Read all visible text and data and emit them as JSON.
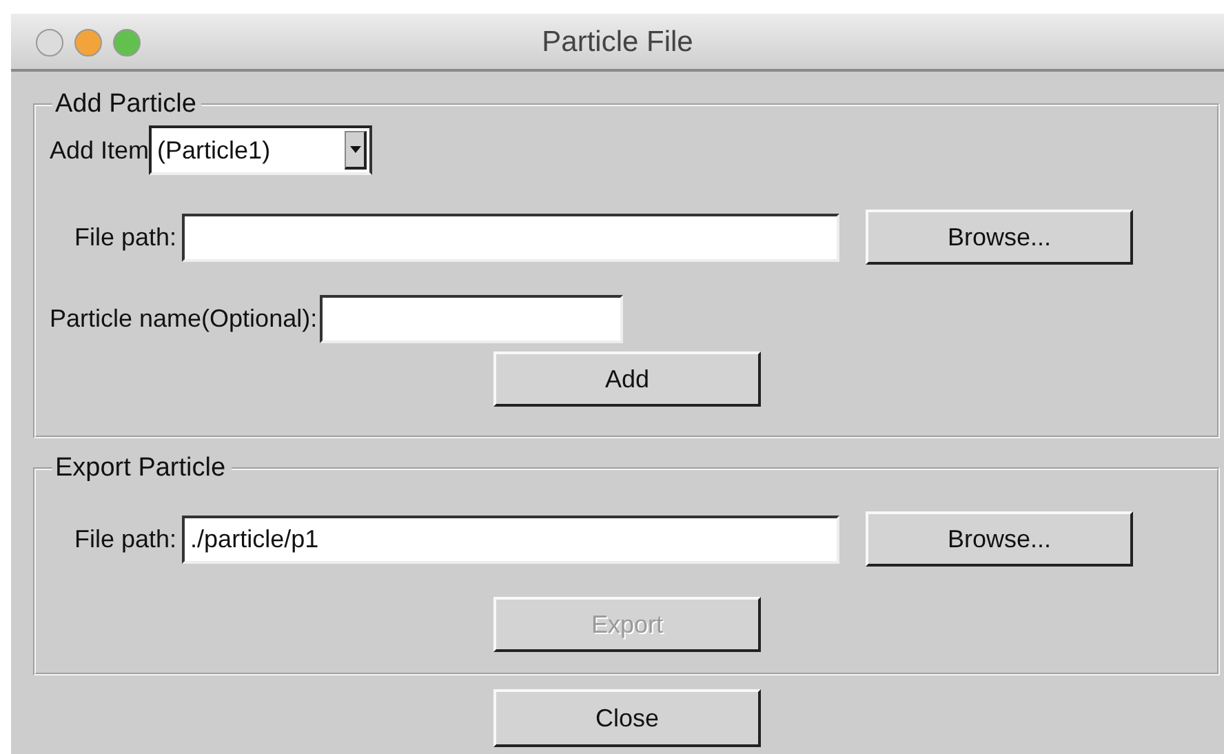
{
  "window": {
    "title": "Particle File",
    "traffic_lights": [
      {
        "color": "#dcdcdc"
      },
      {
        "color": "#f2a33a"
      },
      {
        "color": "#62c04f"
      }
    ]
  },
  "add_particle": {
    "legend": "Add Particle",
    "add_item": {
      "label": "Add Item",
      "value": "(Particle1)"
    },
    "file_path": {
      "label": "File path:"
    },
    "browse_button": {
      "label": "Browse...",
      "disabled": false
    },
    "particle_name": {
      "label": "Particle name(Optional):"
    },
    "add_button": {
      "label": "Add",
      "disabled": false
    }
  },
  "export_particle": {
    "legend": "Export Particle",
    "file_path": {
      "label": "File path:",
      "value": "./particle/p1"
    },
    "browse_button": {
      "label": "Browse...",
      "disabled": false
    },
    "export_button": {
      "label": "Export",
      "disabled": true
    }
  },
  "close_button": {
    "label": "Close",
    "disabled": false
  }
}
